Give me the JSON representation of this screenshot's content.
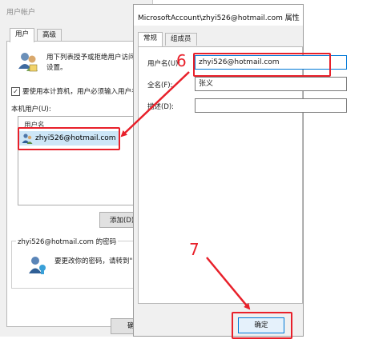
{
  "back_window": {
    "title": "用户帐户",
    "tabs": [
      {
        "label": "用户"
      },
      {
        "label": "高级"
      }
    ],
    "intro_text_line1": "用下列表授予或拒绝用户访问",
    "intro_text_line2": "设置。",
    "require_checkbox": {
      "checked": true,
      "label": "要使用本计算机，用户必须输入用户名"
    },
    "local_users_label": "本机用户(U):",
    "list_header": "用户名",
    "users": [
      {
        "name": "zhyi526@hotmail.com"
      }
    ],
    "add_button_label": "添加(D)",
    "password_group_label": "zhyi526@hotmail.com 的密码",
    "password_text": "要更改你的密码，请转到\"",
    "ok_button_label": "确"
  },
  "front_window": {
    "title": "MicrosoftAccount\\zhyi526@hotmail.com 属性",
    "tabs": [
      {
        "label": "常规"
      },
      {
        "label": "组成员"
      }
    ],
    "fields": {
      "username": {
        "label": "用户名(U):",
        "value": "zhyi526@hotmail.com"
      },
      "fullname": {
        "label": "全名(F):",
        "value": "张义"
      },
      "description": {
        "label": "描述(D):",
        "value": ""
      }
    },
    "ok_button_label": "确定"
  },
  "annotations": {
    "step_6": "6",
    "step_7": "7",
    "color": "#e8202a"
  }
}
